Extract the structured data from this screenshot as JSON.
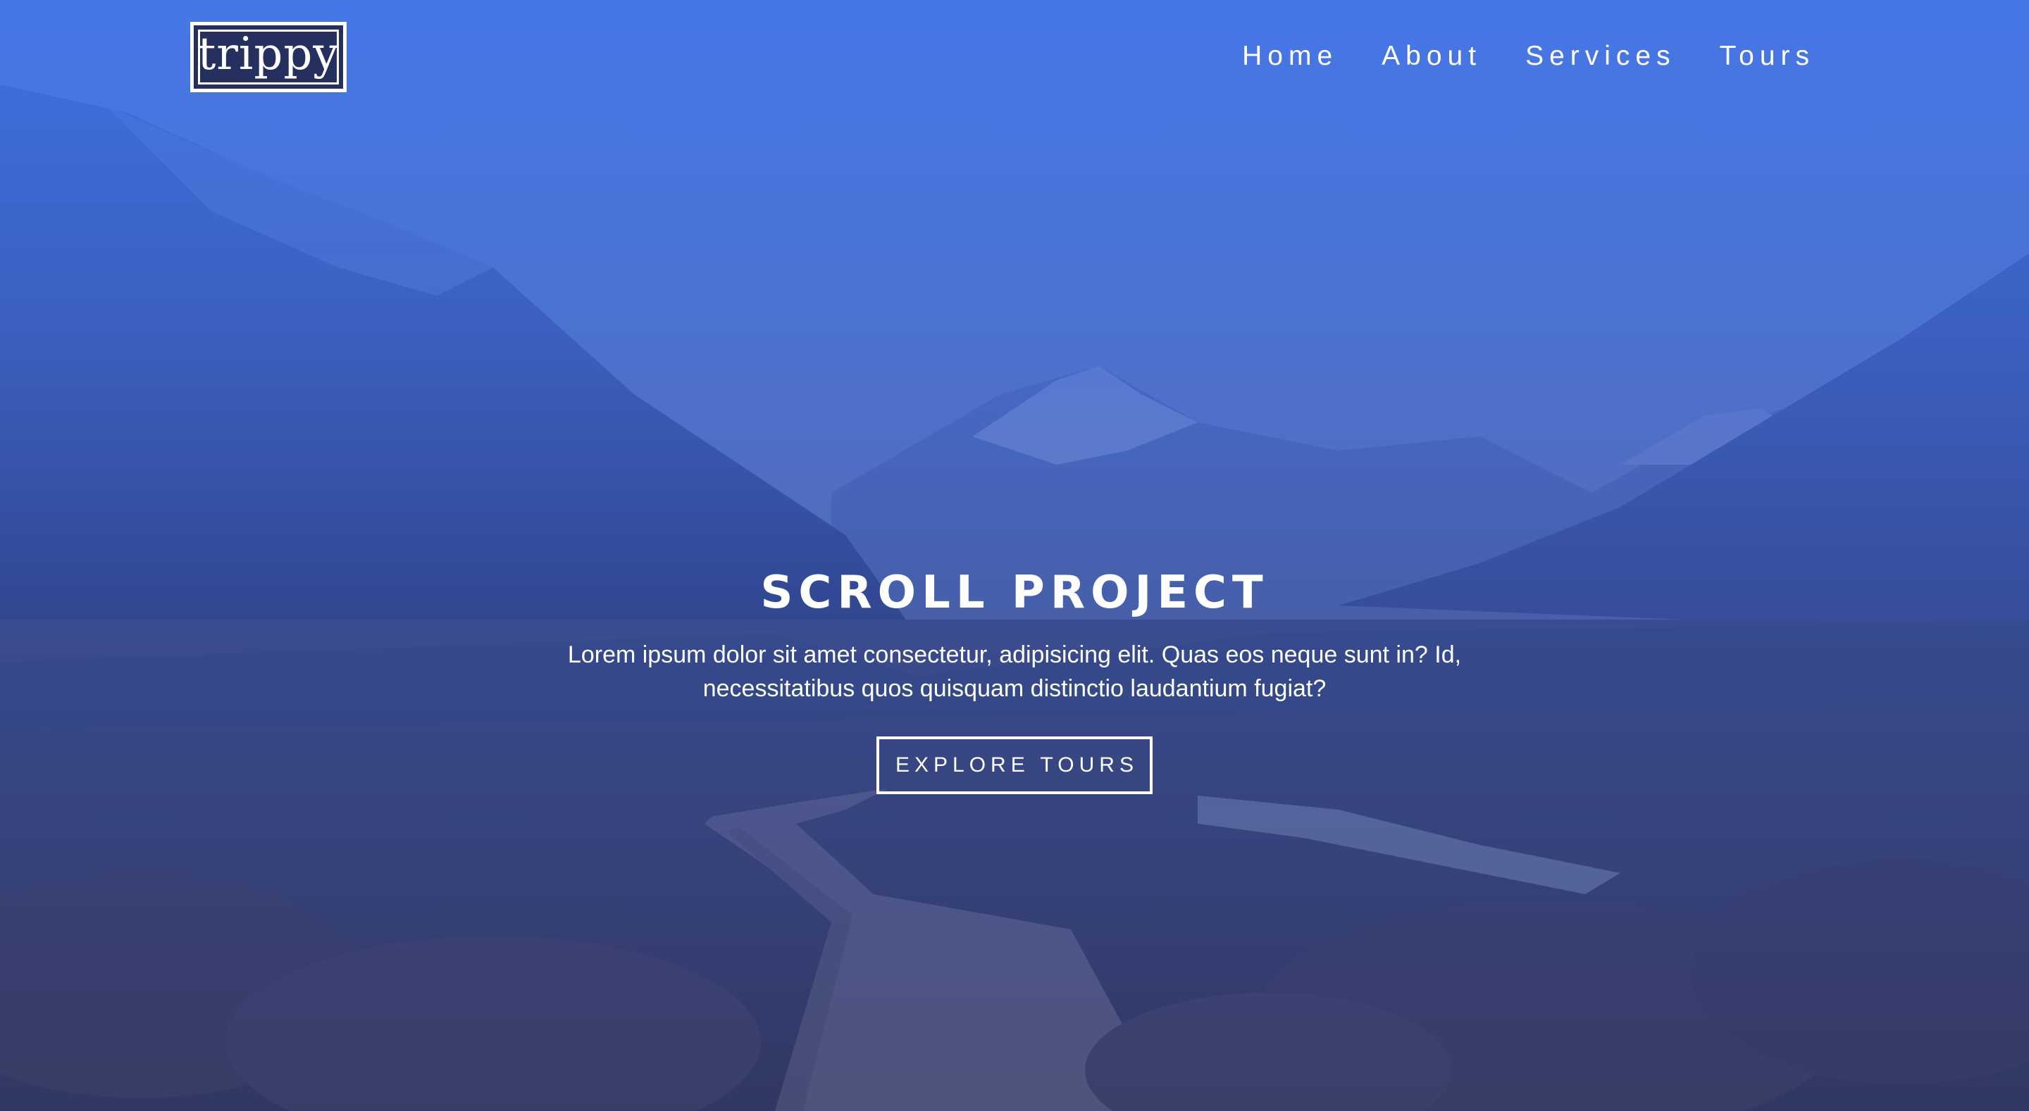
{
  "logo": {
    "text": "trippy"
  },
  "nav": {
    "items": [
      {
        "label": "Home"
      },
      {
        "label": "About"
      },
      {
        "label": "Services"
      },
      {
        "label": "Tours"
      }
    ]
  },
  "banner": {
    "title": "SCROLL PROJECT",
    "text_line1": "Lorem ipsum dolor sit amet consectetur, adipisicing elit. Quas eos neque sunt in? Id,",
    "text_line2": "necessitatibus quos quisquam distinctio laudantium fugiat?",
    "button_label": "EXPLORE TOURS"
  },
  "colors": {
    "overlay_top": "#3e72e8",
    "logo_bg": "#25305e",
    "text": "#ffffff"
  }
}
